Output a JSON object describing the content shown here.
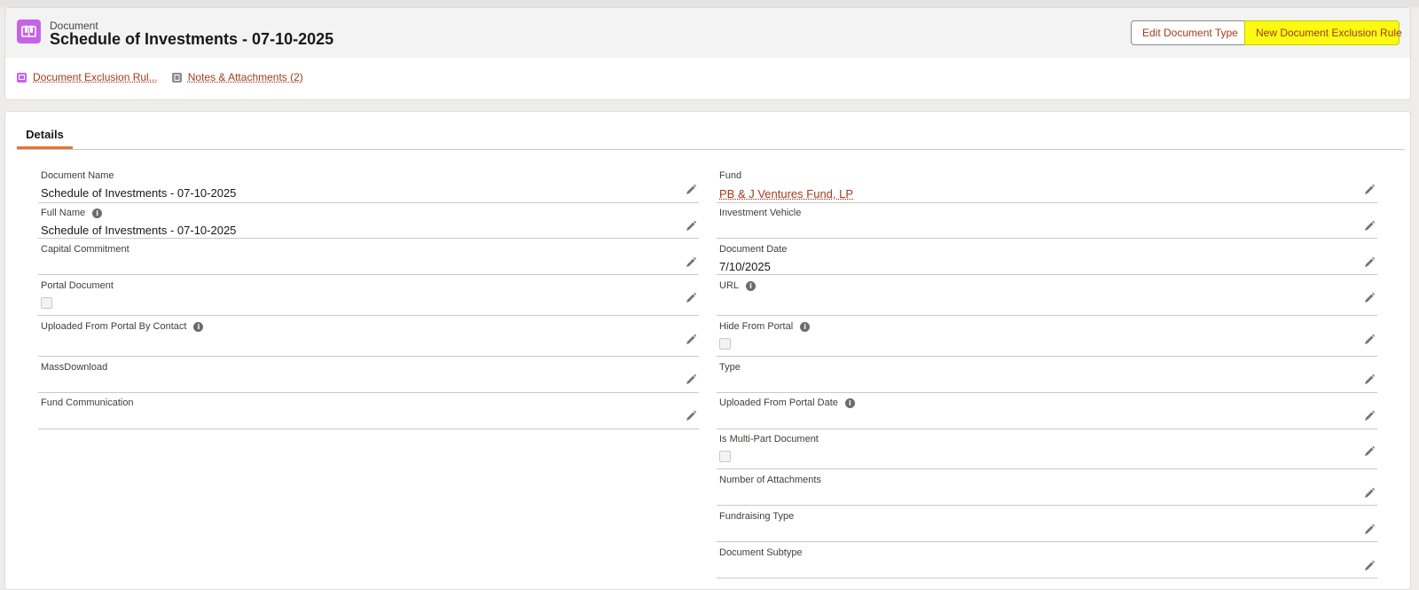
{
  "record": {
    "object_type": "Document",
    "title": "Schedule of Investments - 07-10-2025",
    "icon": "document-book-icon",
    "accent_color": "#c563e8"
  },
  "actions": {
    "edit_document_type": "Edit Document Type",
    "new_exclusion_rule": "New Document Exclusion Rule"
  },
  "related": {
    "exclusion_rules": "Document Exclusion Rul...",
    "notes_attachments": "Notes & Attachments (2)"
  },
  "tabs": {
    "details": "Details"
  },
  "left_fields": [
    {
      "label": "Document Name",
      "value": "Schedule of Investments - 07-10-2025"
    },
    {
      "label": "Full Name",
      "value": "Schedule of Investments - 07-10-2025"
    },
    {
      "label": "Capital Commitment",
      "value": ""
    },
    {
      "label": "Portal Document",
      "value": ""
    },
    {
      "label": "Uploaded From Portal By Contact",
      "value": ""
    },
    {
      "label": "MassDownload",
      "value": ""
    },
    {
      "label": "Fund Communication",
      "value": ""
    }
  ],
  "right_fields": [
    {
      "label": "Fund",
      "value": "PB & J Ventures Fund, LP"
    },
    {
      "label": "Investment Vehicle",
      "value": ""
    },
    {
      "label": "Document Date",
      "value": "7/10/2025"
    },
    {
      "label": "URL",
      "value": ""
    },
    {
      "label": "Hide From Portal",
      "value": ""
    },
    {
      "label": "Type",
      "value": ""
    },
    {
      "label": "Uploaded From Portal Date",
      "value": ""
    },
    {
      "label": "Is Multi-Part Document",
      "value": ""
    },
    {
      "label": "Number of Attachments",
      "value": ""
    },
    {
      "label": "Fundraising Type",
      "value": ""
    },
    {
      "label": "Document Subtype",
      "value": ""
    }
  ]
}
